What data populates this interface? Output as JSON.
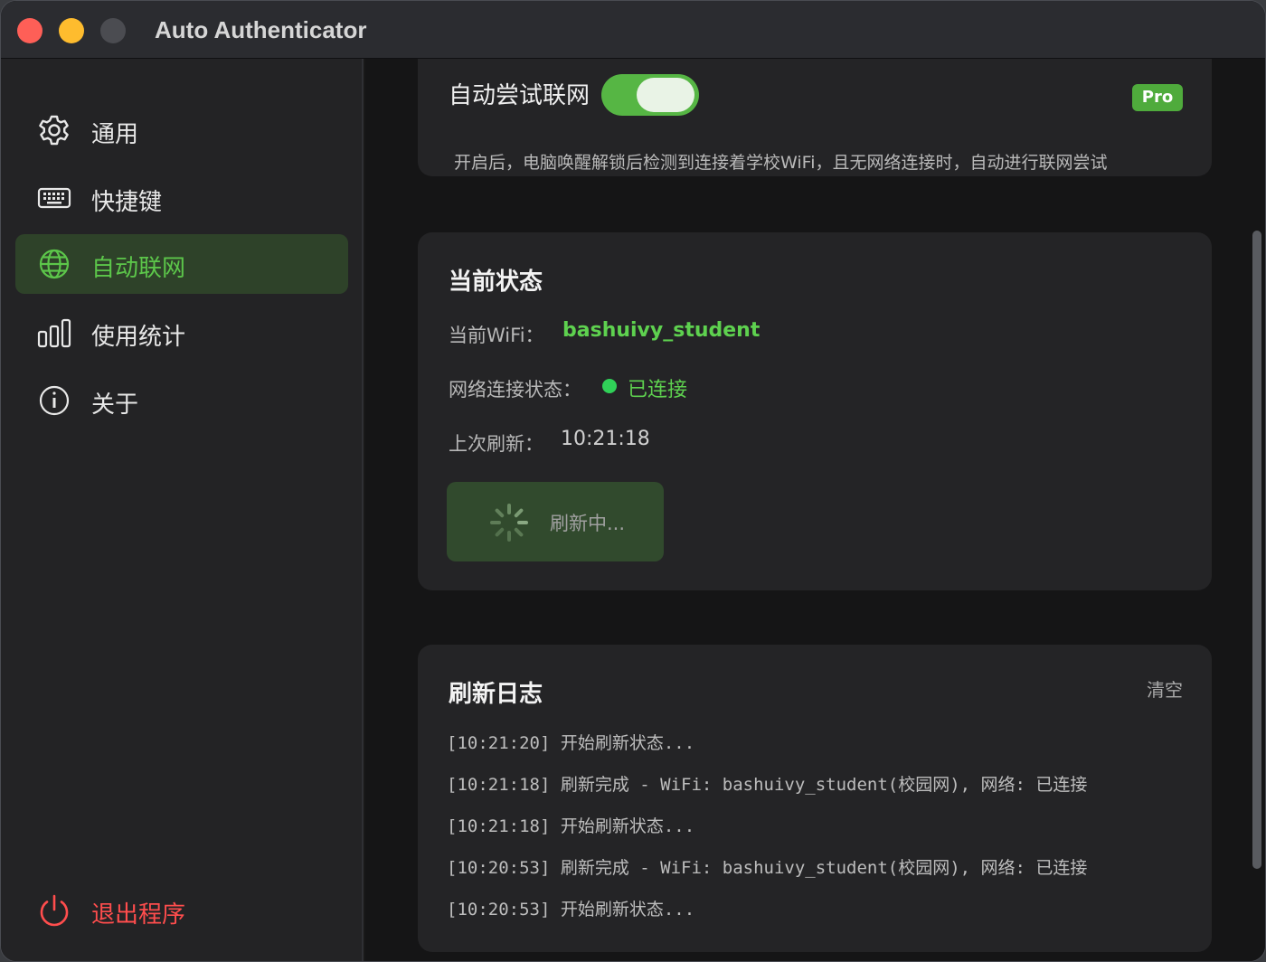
{
  "window": {
    "title": "Auto Authenticator"
  },
  "sidebar": {
    "items": [
      {
        "label": "通用",
        "icon": "gear-icon"
      },
      {
        "label": "快捷键",
        "icon": "keyboard-icon"
      },
      {
        "label": "自动联网",
        "icon": "globe-icon",
        "active": true
      },
      {
        "label": "使用统计",
        "icon": "bar-chart-icon"
      },
      {
        "label": "关于",
        "icon": "info-icon"
      }
    ],
    "quit": {
      "label": "退出程序",
      "icon": "power-icon"
    }
  },
  "auto_connect": {
    "label": "自动尝试联网",
    "enabled": true,
    "badge": "Pro",
    "description": "开启后，电脑唤醒解锁后检测到连接着学校WiFi，且无网络连接时，自动进行联网尝试"
  },
  "status": {
    "title": "当前状态",
    "wifi_label": "当前WiFi：",
    "wifi_value": "bashuivy_student",
    "network_label": "网络连接状态：",
    "network_value": "已连接",
    "refresh_label": "上次刷新：",
    "refresh_value": "10:21:18",
    "button_label": "刷新中..."
  },
  "log": {
    "title": "刷新日志",
    "clear_label": "清空",
    "lines": [
      "[10:21:20] 开始刷新状态...",
      "[10:21:18] 刷新完成 - WiFi: bashuivy_student(校园网), 网络: 已连接",
      "[10:21:18] 开始刷新状态...",
      "[10:20:53] 刷新完成 - WiFi: bashuivy_student(校园网), 网络: 已连接",
      "[10:20:53] 开始刷新状态..."
    ]
  },
  "colors": {
    "accent": "#5cc64a",
    "quit": "#ff4d4d",
    "connected_dot": "#30d158"
  }
}
